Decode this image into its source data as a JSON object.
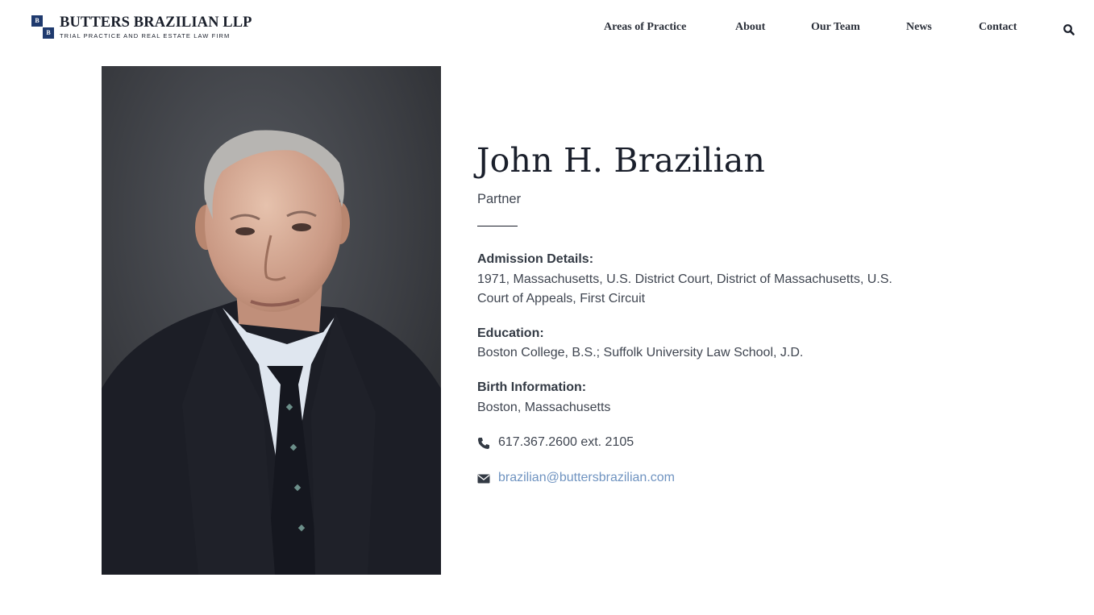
{
  "brand": {
    "name": "BUTTERS BRAZILIAN LLP",
    "tagline": "TRIAL PRACTICE AND REAL ESTATE LAW FIRM",
    "mark_letter_1": "B",
    "mark_letter_2": "B",
    "color": "#1f3a6e"
  },
  "nav": {
    "items": [
      {
        "label": "Areas of Practice"
      },
      {
        "label": "About"
      },
      {
        "label": "Our Team"
      },
      {
        "label": "News"
      },
      {
        "label": "Contact"
      }
    ],
    "search_icon": "search-icon"
  },
  "profile": {
    "photo": "attorney-portrait",
    "name": "John H. Brazilian",
    "role": "Partner",
    "sections": [
      {
        "label": "Admission Details:",
        "value": "1971, Massachusetts, U.S. District Court, District of Massachusetts, U.S. Court of Appeals, First Circuit"
      },
      {
        "label": "Education:",
        "value": "Boston College, B.S.; Suffolk University Law School, J.D."
      },
      {
        "label": "Birth Information:",
        "value": "Boston, Massachusetts"
      }
    ],
    "phone": {
      "icon": "phone-icon",
      "text": "617.367.2600 ext. 2105"
    },
    "email": {
      "icon": "envelope-icon",
      "text": "brazilian@buttersbrazilian.com",
      "color": "#6f93c0"
    }
  }
}
